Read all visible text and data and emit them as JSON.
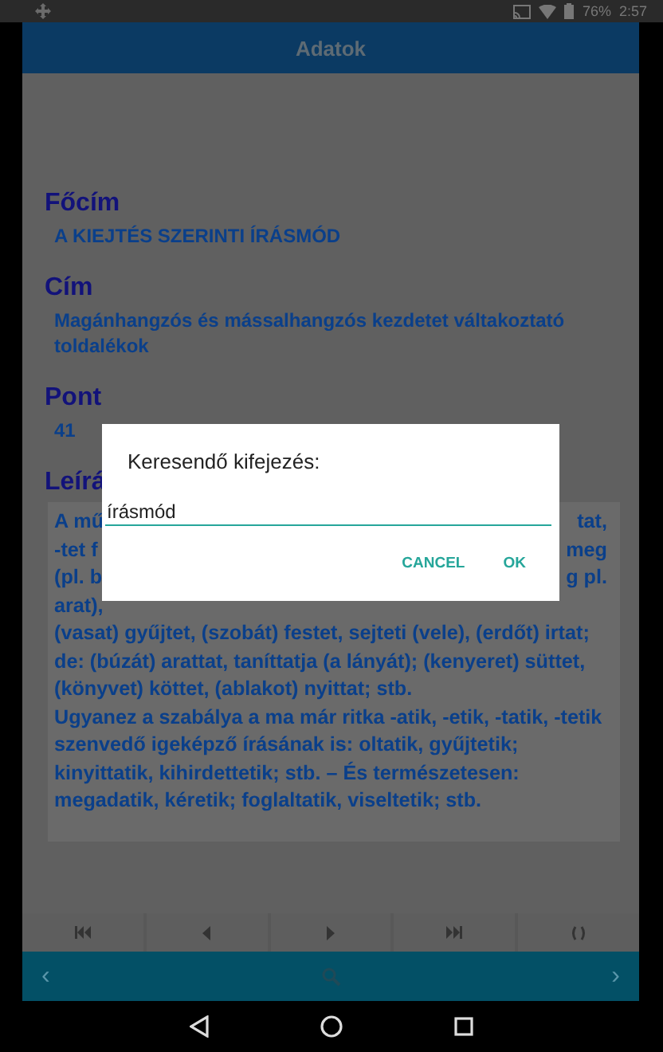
{
  "status_bar": {
    "battery": "76%",
    "time": "2:57"
  },
  "app_bar": {
    "title": "Adatok"
  },
  "fields": [
    {
      "label": "Főcím",
      "value": "A KIEJTÉS SZERINTI ÍRÁSMÓD"
    },
    {
      "label": "Cím",
      "value": "Magánhangzós és mássalhangzós kezdetet váltakoztató toldalékok"
    },
    {
      "label": "Pont",
      "value": "41"
    }
  ],
  "description": {
    "label": "Leírá",
    "fragments": [
      {
        "left": "A mű",
        "right": "tat,"
      },
      {
        "left": "-tet f",
        "right": "meg"
      },
      {
        "left": "(pl. b",
        "right": "g pl."
      },
      {
        "left": "arat),"
      }
    ],
    "paragraphs": [
      "(vasat) gyűjtet, (szobát) festet, sejteti (vele), (erdőt) irtat; de: (búzát) arattat, taníttatja (a lányát); (kenyeret) süttet, (könyvet) köttet, (ablakot) nyittat; stb.",
      "Ugyanez a szabálya a ma már ritka -atik, -etik, -tatik, -tetik szenvedő igeképző írásának is: oltatik, gyűjtetik; kinyittatik, kihirdettetik; stb. – És természetesen: megadatik, kéretik; foglaltatik, viseltetik; stb."
    ]
  },
  "toolbar": [
    {
      "kind": "first"
    },
    {
      "kind": "prev"
    },
    {
      "kind": "next"
    },
    {
      "kind": "last"
    },
    {
      "kind": "swap"
    }
  ],
  "nav": {
    "back": "‹",
    "forward": "›"
  },
  "dialog": {
    "title": "Keresendő kifejezés:",
    "value": "írásmód",
    "buttons": [
      "CANCEL",
      "OK"
    ]
  }
}
